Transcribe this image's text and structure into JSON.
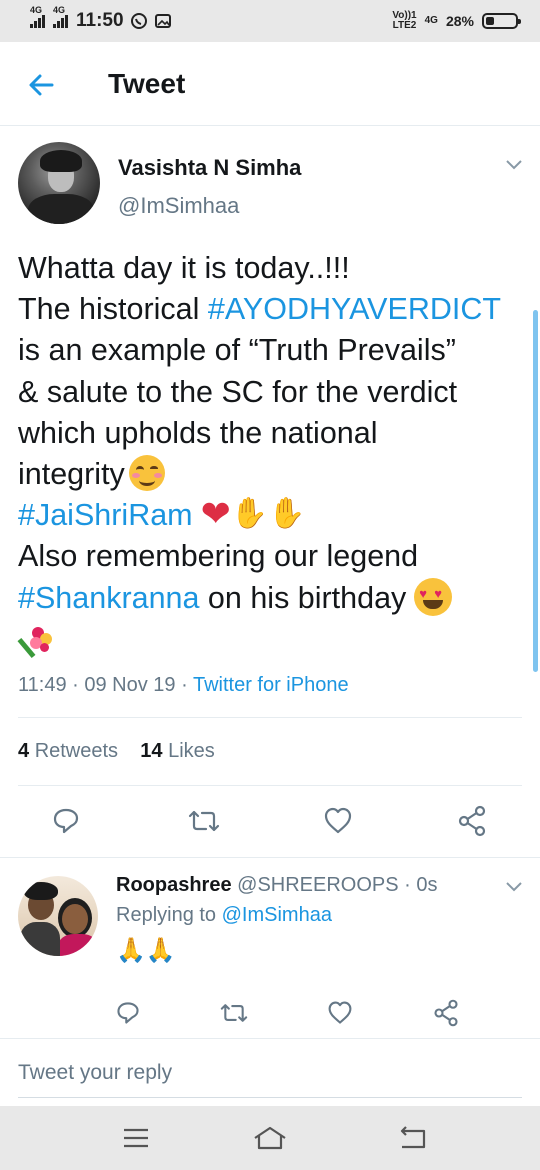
{
  "status_bar": {
    "net1": "4G",
    "net2": "4G",
    "time": "11:50",
    "volte": "Vo))1",
    "lte": "LTE2",
    "net3": "4G",
    "battery": "28%",
    "battery_level": 0.28
  },
  "header": {
    "title": "Tweet"
  },
  "tweet": {
    "author_name": "Vasishta N Simha",
    "author_handle": "@ImSimhaa",
    "lines": [
      {
        "pre": "Whatta day it is today..!!!"
      },
      {
        "pre": "The historical ",
        "tag": "#AYODHYAVERDICT"
      },
      {
        "pre": "is an example of “Truth Prevails”"
      },
      {
        "pre": "& salute to the SC for the verdict"
      },
      {
        "pre": "which upholds the national"
      },
      {
        "pre": "integrity"
      },
      {
        "tag": "#JaiShriRam"
      },
      {
        "pre": "Also remembering our legend"
      },
      {
        "tag": "#Shankranna",
        "post": " on his birthday"
      }
    ],
    "emoji": {
      "smile": "smiling-face-with-smiling-eyes",
      "heart": "red-heart",
      "pray": "folded-hands",
      "love": "heart-eyes",
      "bouquet": "bouquet"
    },
    "time": "11:49",
    "date": "09 Nov 19",
    "source": "Twitter for iPhone",
    "retweets_count": "4",
    "retweets_label": "Retweets",
    "likes_count": "14",
    "likes_label": "Likes"
  },
  "reply": {
    "name": "Roopashree",
    "handle": "@SHREEROOPS",
    "time": "0s",
    "replying_prefix": "Replying to ",
    "replying_to": "@ImSimhaa",
    "text": "🙏🙏"
  },
  "compose": {
    "placeholder": "Tweet your reply"
  },
  "icons": {
    "back": "back-arrow-icon",
    "caret": "chevron-down-icon",
    "reply": "reply-icon",
    "retweet": "retweet-icon",
    "like": "like-icon",
    "share": "share-icon",
    "menu": "menu-icon",
    "home": "home-icon",
    "nav_back": "nav-back-icon"
  },
  "colors": {
    "accent": "#1b95e0",
    "text": "#14171a",
    "muted": "#657786",
    "heart": "#dd2e44"
  }
}
